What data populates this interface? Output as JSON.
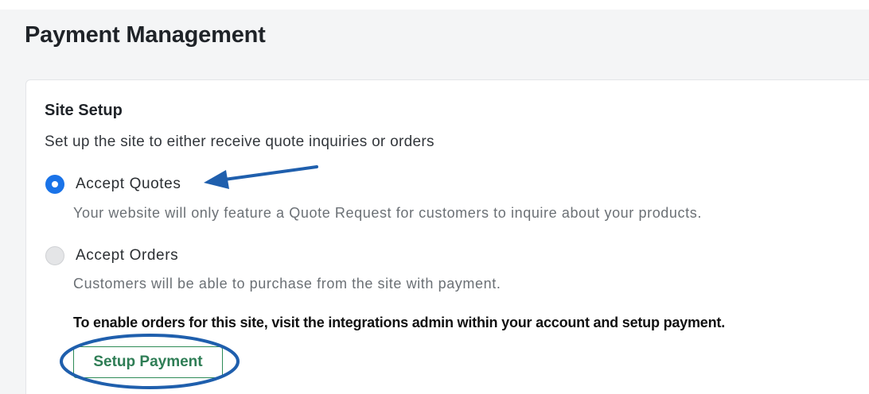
{
  "header": {
    "title": "Payment Management"
  },
  "site_setup": {
    "title": "Site Setup",
    "description": "Set up the site to either receive quote inquiries or orders",
    "options": [
      {
        "label": "Accept Quotes",
        "description": "Your website will only feature a Quote Request for customers to inquire about your products.",
        "selected": true
      },
      {
        "label": "Accept Orders",
        "description": "Customers will be able to purchase from the site with payment.",
        "selected": false
      }
    ],
    "note": "To enable orders for this site, visit the integrations admin within your account and setup payment.",
    "setup_button_label": "Setup Payment"
  },
  "colors": {
    "accent": "#1a73e8",
    "button_text": "#2e7d55",
    "annotation": "#1f5fad"
  }
}
